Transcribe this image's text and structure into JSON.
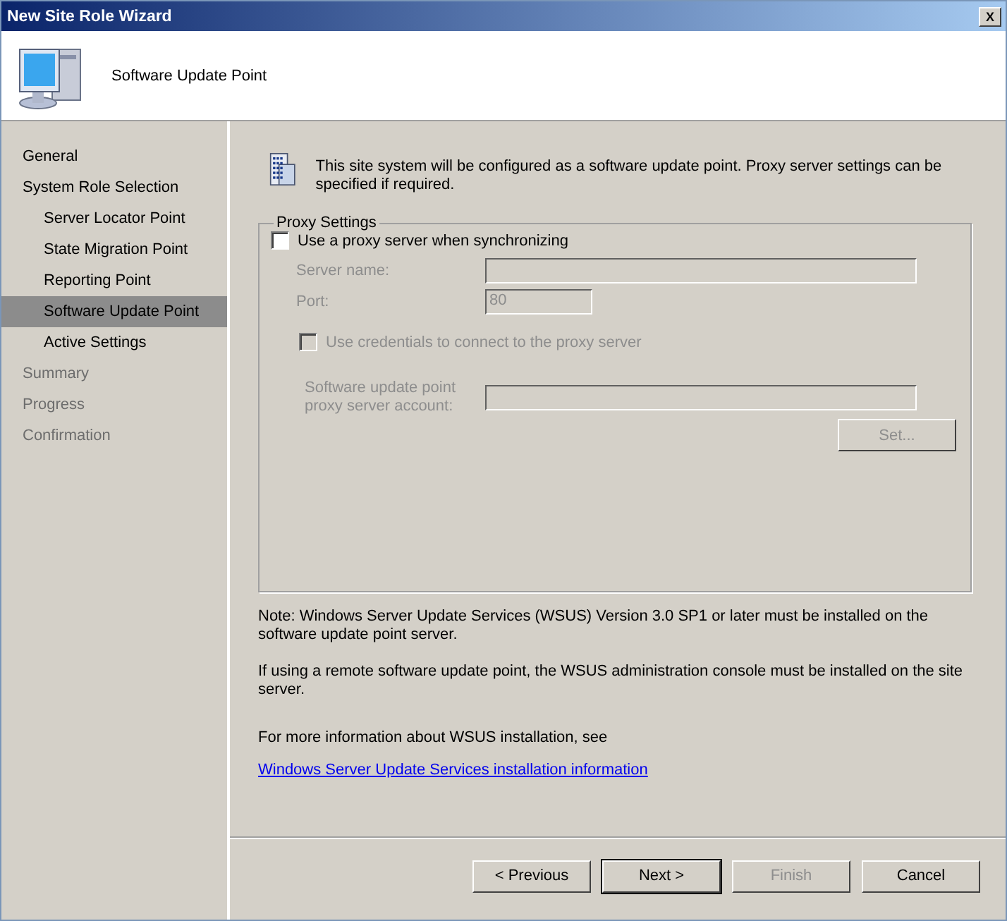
{
  "window": {
    "title": "New Site Role Wizard",
    "close": "X"
  },
  "header": {
    "title": "Software Update Point"
  },
  "sidebar": {
    "items": [
      {
        "label": "General",
        "selected": false,
        "disabled": false
      },
      {
        "label": "System Role Selection",
        "selected": false,
        "disabled": false,
        "children": [
          {
            "label": "Server Locator Point",
            "selected": false,
            "disabled": false
          },
          {
            "label": "State Migration Point",
            "selected": false,
            "disabled": false
          },
          {
            "label": "Reporting Point",
            "selected": false,
            "disabled": false
          },
          {
            "label": "Software Update Point",
            "selected": true,
            "disabled": false
          },
          {
            "label": "Active Settings",
            "selected": false,
            "disabled": false
          }
        ]
      },
      {
        "label": "Summary",
        "selected": false,
        "disabled": true
      },
      {
        "label": "Progress",
        "selected": false,
        "disabled": true
      },
      {
        "label": "Confirmation",
        "selected": false,
        "disabled": true
      }
    ]
  },
  "intro": "This site system will be configured as a software update point. Proxy server settings can be specified if required.",
  "proxy_settings": {
    "legend": "Proxy Settings",
    "use_proxy": {
      "label": "Use a proxy server when synchronizing",
      "checked": false,
      "disabled": false
    },
    "server_name": {
      "label": "Server name:",
      "disabled": true
    },
    "port": {
      "label": "Port:",
      "value": "80",
      "disabled": true
    },
    "use_credentials": {
      "label": "Use credentials to connect to the proxy server",
      "checked": false,
      "disabled": true
    },
    "account": {
      "label": "Software update point proxy server account:",
      "disabled": true
    },
    "set_button": {
      "label": "Set...",
      "disabled": true
    }
  },
  "notes": [
    "Note: Windows Server Update Services (WSUS) Version 3.0 SP1 or later must be installed on the software update point server.",
    "If using a remote software update point, the WSUS administration console must be installed on the site server."
  ],
  "more_info": "For more information about WSUS installation, see",
  "link": "Windows Server Update Services installation information",
  "buttons": [
    {
      "label": "< Previous",
      "disabled": false,
      "default": false
    },
    {
      "label": "Next >",
      "disabled": false,
      "default": true
    },
    {
      "label": "Finish",
      "disabled": true,
      "default": false
    },
    {
      "label": "Cancel",
      "disabled": false,
      "default": false
    }
  ]
}
